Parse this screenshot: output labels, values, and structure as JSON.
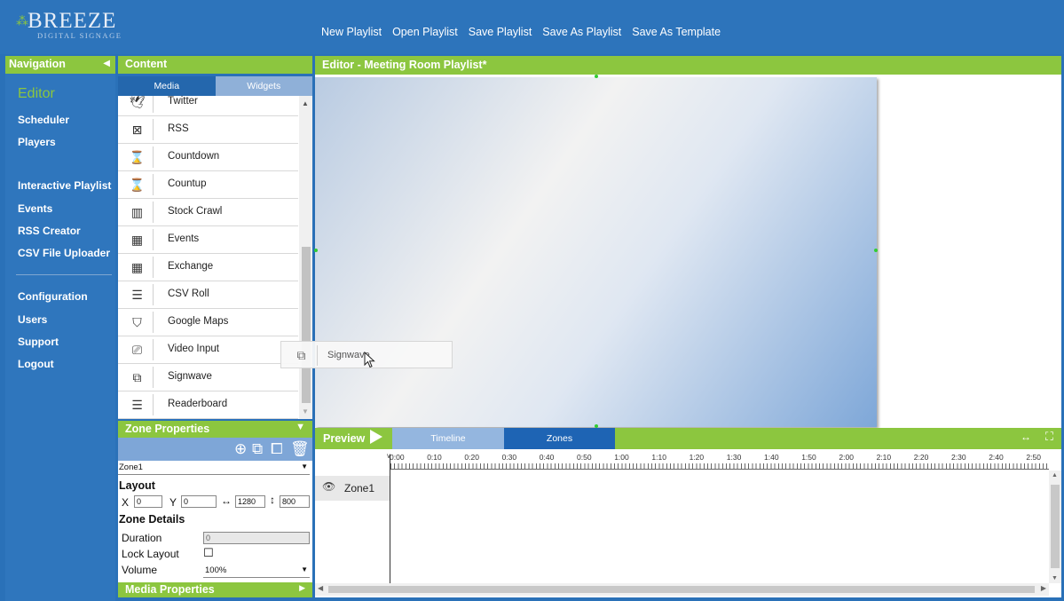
{
  "logo": {
    "name": "BREEZE",
    "subtitle": "DIGITAL SIGNAGE"
  },
  "menu": [
    "New Playlist",
    "Open Playlist",
    "Save Playlist",
    "Save As Playlist",
    "Save As Template"
  ],
  "navigation": {
    "header": "Navigation",
    "items": [
      "Editor",
      "Scheduler",
      "Players",
      "Interactive Playlist",
      "Events",
      "RSS Creator",
      "CSV File Uploader",
      "Configuration",
      "Users",
      "Support",
      "Logout"
    ]
  },
  "content": {
    "header": "Content",
    "tabs": {
      "media": "Media",
      "widgets": "Widgets"
    },
    "widgets": [
      {
        "label": "Twitter",
        "icon": "twitter-icon"
      },
      {
        "label": "RSS",
        "icon": "rss-icon"
      },
      {
        "label": "Countdown",
        "icon": "hourglass-icon"
      },
      {
        "label": "Countup",
        "icon": "hourglass-icon"
      },
      {
        "label": "Stock Crawl",
        "icon": "stock-chart-icon"
      },
      {
        "label": "Events",
        "icon": "calendar-icon"
      },
      {
        "label": "Exchange",
        "icon": "calendar-icon"
      },
      {
        "label": "CSV Roll",
        "icon": "list-icon"
      },
      {
        "label": "Google Maps",
        "icon": "map-icon"
      },
      {
        "label": "Video Input",
        "icon": "video-input-icon"
      },
      {
        "label": "Signwave",
        "icon": "signwave-icon"
      },
      {
        "label": "Readerboard",
        "icon": "list-icon"
      }
    ]
  },
  "zone_properties": {
    "header": "Zone Properties",
    "zone_select": "Zone1",
    "layout_label": "Layout",
    "x_label": "X",
    "x_value": "0",
    "y_label": "Y",
    "y_value": "0",
    "width_value": "1280",
    "height_value": "800",
    "details_label": "Zone Details",
    "duration_label": "Duration",
    "duration_value": "0",
    "lock_layout_label": "Lock Layout",
    "volume_label": "Volume",
    "volume_value": "100%"
  },
  "media_properties": {
    "header": "Media Properties"
  },
  "editor": {
    "header": "Editor - Meeting Room Playlist*"
  },
  "drag_ghost": {
    "label": "Signwave"
  },
  "preview": {
    "label": "Preview",
    "tabs": {
      "timeline": "Timeline",
      "zones": "Zones"
    }
  },
  "timeline": {
    "ticks": [
      "0:00",
      "0:10",
      "0:20",
      "0:30",
      "0:40",
      "0:50",
      "1:00",
      "1:10",
      "1:20",
      "1:30",
      "1:40",
      "1:50",
      "2:00",
      "2:10",
      "2:20",
      "2:30",
      "2:40",
      "2:50"
    ],
    "zone_label": "Zone1"
  },
  "colors": {
    "accent_green": "#8cc63f",
    "brand_blue": "#2d74bb",
    "selected_tab": "#1e64b4"
  }
}
